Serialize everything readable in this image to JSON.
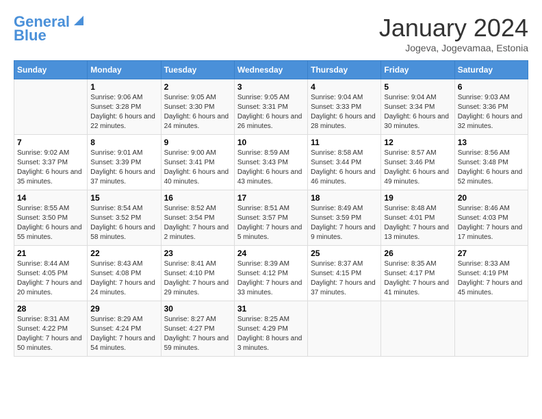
{
  "logo": {
    "line1": "General",
    "line2": "Blue"
  },
  "title": "January 2024",
  "subtitle": "Jogeva, Jogevamaa, Estonia",
  "weekdays": [
    "Sunday",
    "Monday",
    "Tuesday",
    "Wednesday",
    "Thursday",
    "Friday",
    "Saturday"
  ],
  "weeks": [
    [
      {
        "day": "",
        "sunrise": "",
        "sunset": "",
        "daylight": ""
      },
      {
        "day": "1",
        "sunrise": "Sunrise: 9:06 AM",
        "sunset": "Sunset: 3:28 PM",
        "daylight": "Daylight: 6 hours and 22 minutes."
      },
      {
        "day": "2",
        "sunrise": "Sunrise: 9:05 AM",
        "sunset": "Sunset: 3:30 PM",
        "daylight": "Daylight: 6 hours and 24 minutes."
      },
      {
        "day": "3",
        "sunrise": "Sunrise: 9:05 AM",
        "sunset": "Sunset: 3:31 PM",
        "daylight": "Daylight: 6 hours and 26 minutes."
      },
      {
        "day": "4",
        "sunrise": "Sunrise: 9:04 AM",
        "sunset": "Sunset: 3:33 PM",
        "daylight": "Daylight: 6 hours and 28 minutes."
      },
      {
        "day": "5",
        "sunrise": "Sunrise: 9:04 AM",
        "sunset": "Sunset: 3:34 PM",
        "daylight": "Daylight: 6 hours and 30 minutes."
      },
      {
        "day": "6",
        "sunrise": "Sunrise: 9:03 AM",
        "sunset": "Sunset: 3:36 PM",
        "daylight": "Daylight: 6 hours and 32 minutes."
      }
    ],
    [
      {
        "day": "7",
        "sunrise": "Sunrise: 9:02 AM",
        "sunset": "Sunset: 3:37 PM",
        "daylight": "Daylight: 6 hours and 35 minutes."
      },
      {
        "day": "8",
        "sunrise": "Sunrise: 9:01 AM",
        "sunset": "Sunset: 3:39 PM",
        "daylight": "Daylight: 6 hours and 37 minutes."
      },
      {
        "day": "9",
        "sunrise": "Sunrise: 9:00 AM",
        "sunset": "Sunset: 3:41 PM",
        "daylight": "Daylight: 6 hours and 40 minutes."
      },
      {
        "day": "10",
        "sunrise": "Sunrise: 8:59 AM",
        "sunset": "Sunset: 3:43 PM",
        "daylight": "Daylight: 6 hours and 43 minutes."
      },
      {
        "day": "11",
        "sunrise": "Sunrise: 8:58 AM",
        "sunset": "Sunset: 3:44 PM",
        "daylight": "Daylight: 6 hours and 46 minutes."
      },
      {
        "day": "12",
        "sunrise": "Sunrise: 8:57 AM",
        "sunset": "Sunset: 3:46 PM",
        "daylight": "Daylight: 6 hours and 49 minutes."
      },
      {
        "day": "13",
        "sunrise": "Sunrise: 8:56 AM",
        "sunset": "Sunset: 3:48 PM",
        "daylight": "Daylight: 6 hours and 52 minutes."
      }
    ],
    [
      {
        "day": "14",
        "sunrise": "Sunrise: 8:55 AM",
        "sunset": "Sunset: 3:50 PM",
        "daylight": "Daylight: 6 hours and 55 minutes."
      },
      {
        "day": "15",
        "sunrise": "Sunrise: 8:54 AM",
        "sunset": "Sunset: 3:52 PM",
        "daylight": "Daylight: 6 hours and 58 minutes."
      },
      {
        "day": "16",
        "sunrise": "Sunrise: 8:52 AM",
        "sunset": "Sunset: 3:54 PM",
        "daylight": "Daylight: 7 hours and 2 minutes."
      },
      {
        "day": "17",
        "sunrise": "Sunrise: 8:51 AM",
        "sunset": "Sunset: 3:57 PM",
        "daylight": "Daylight: 7 hours and 5 minutes."
      },
      {
        "day": "18",
        "sunrise": "Sunrise: 8:49 AM",
        "sunset": "Sunset: 3:59 PM",
        "daylight": "Daylight: 7 hours and 9 minutes."
      },
      {
        "day": "19",
        "sunrise": "Sunrise: 8:48 AM",
        "sunset": "Sunset: 4:01 PM",
        "daylight": "Daylight: 7 hours and 13 minutes."
      },
      {
        "day": "20",
        "sunrise": "Sunrise: 8:46 AM",
        "sunset": "Sunset: 4:03 PM",
        "daylight": "Daylight: 7 hours and 17 minutes."
      }
    ],
    [
      {
        "day": "21",
        "sunrise": "Sunrise: 8:44 AM",
        "sunset": "Sunset: 4:05 PM",
        "daylight": "Daylight: 7 hours and 20 minutes."
      },
      {
        "day": "22",
        "sunrise": "Sunrise: 8:43 AM",
        "sunset": "Sunset: 4:08 PM",
        "daylight": "Daylight: 7 hours and 24 minutes."
      },
      {
        "day": "23",
        "sunrise": "Sunrise: 8:41 AM",
        "sunset": "Sunset: 4:10 PM",
        "daylight": "Daylight: 7 hours and 29 minutes."
      },
      {
        "day": "24",
        "sunrise": "Sunrise: 8:39 AM",
        "sunset": "Sunset: 4:12 PM",
        "daylight": "Daylight: 7 hours and 33 minutes."
      },
      {
        "day": "25",
        "sunrise": "Sunrise: 8:37 AM",
        "sunset": "Sunset: 4:15 PM",
        "daylight": "Daylight: 7 hours and 37 minutes."
      },
      {
        "day": "26",
        "sunrise": "Sunrise: 8:35 AM",
        "sunset": "Sunset: 4:17 PM",
        "daylight": "Daylight: 7 hours and 41 minutes."
      },
      {
        "day": "27",
        "sunrise": "Sunrise: 8:33 AM",
        "sunset": "Sunset: 4:19 PM",
        "daylight": "Daylight: 7 hours and 45 minutes."
      }
    ],
    [
      {
        "day": "28",
        "sunrise": "Sunrise: 8:31 AM",
        "sunset": "Sunset: 4:22 PM",
        "daylight": "Daylight: 7 hours and 50 minutes."
      },
      {
        "day": "29",
        "sunrise": "Sunrise: 8:29 AM",
        "sunset": "Sunset: 4:24 PM",
        "daylight": "Daylight: 7 hours and 54 minutes."
      },
      {
        "day": "30",
        "sunrise": "Sunrise: 8:27 AM",
        "sunset": "Sunset: 4:27 PM",
        "daylight": "Daylight: 7 hours and 59 minutes."
      },
      {
        "day": "31",
        "sunrise": "Sunrise: 8:25 AM",
        "sunset": "Sunset: 4:29 PM",
        "daylight": "Daylight: 8 hours and 3 minutes."
      },
      {
        "day": "",
        "sunrise": "",
        "sunset": "",
        "daylight": ""
      },
      {
        "day": "",
        "sunrise": "",
        "sunset": "",
        "daylight": ""
      },
      {
        "day": "",
        "sunrise": "",
        "sunset": "",
        "daylight": ""
      }
    ]
  ]
}
